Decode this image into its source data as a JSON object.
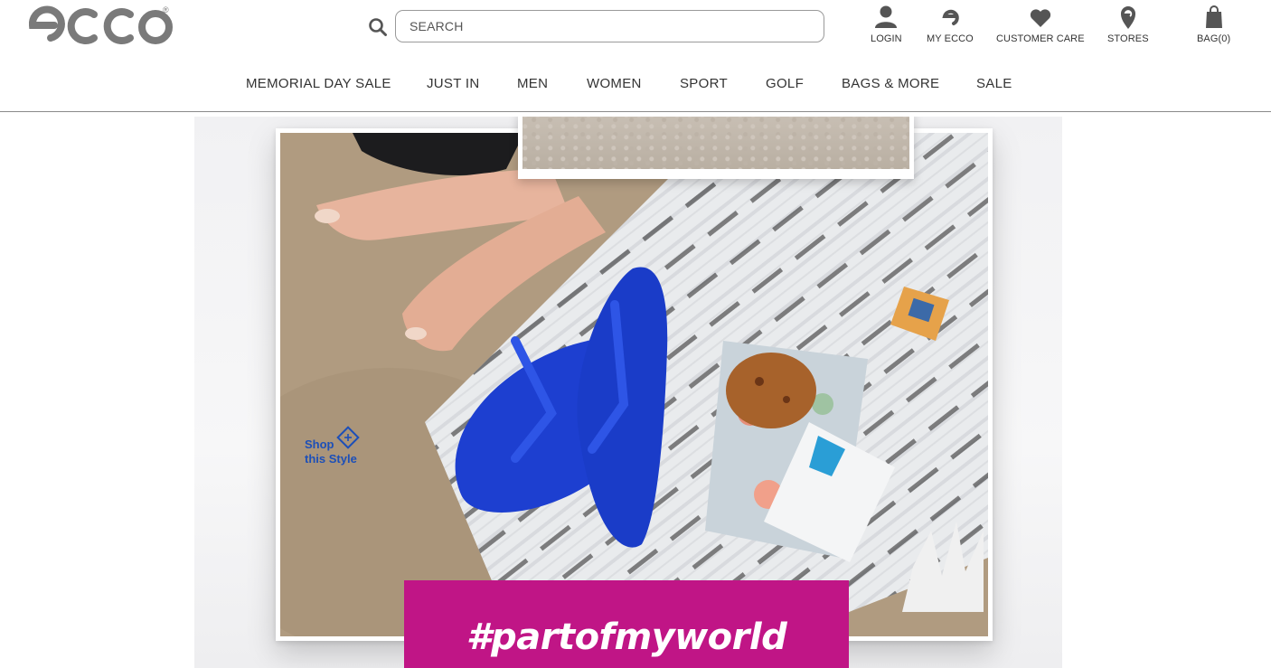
{
  "brand": {
    "logo_text": "ecco",
    "registered_mark": "®"
  },
  "search": {
    "placeholder": "SEARCH"
  },
  "utility_nav": [
    {
      "label": "LOGIN",
      "icon": "user-icon"
    },
    {
      "label": "MY ECCO",
      "icon": "ecco-e-icon"
    },
    {
      "label": "CUSTOMER CARE",
      "icon": "heart-icon"
    },
    {
      "label": "STORES",
      "icon": "map-pin-icon"
    },
    {
      "label": "BAG(0)",
      "icon": "bag-icon"
    }
  ],
  "main_nav": [
    {
      "label": "MEMORIAL DAY SALE"
    },
    {
      "label": "JUST IN"
    },
    {
      "label": "MEN"
    },
    {
      "label": "WOMEN"
    },
    {
      "label": "SPORT"
    },
    {
      "label": "GOLF"
    },
    {
      "label": "BAGS & MORE"
    },
    {
      "label": "SALE"
    }
  ],
  "hero": {
    "shop_link": {
      "line1": "Shop",
      "line2": "this Style",
      "icon": "plus-diamond-icon"
    },
    "hashtag": "#partofmyworld",
    "colors": {
      "hashtag_bg": "#c01586",
      "shop_link": "#1c4fb8",
      "flip_flop": "#1d3fd0"
    }
  }
}
